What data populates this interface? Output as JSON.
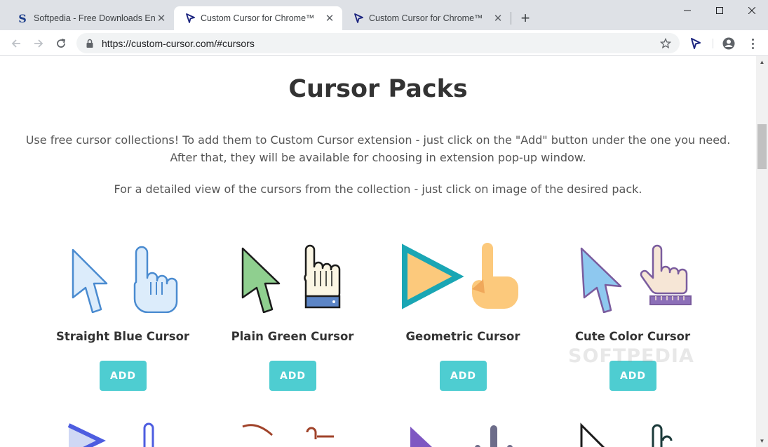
{
  "browser": {
    "tabs": [
      {
        "title": "Softpedia - Free Downloads Ency",
        "icon": "softpedia-icon",
        "active": false
      },
      {
        "title": "Custom Cursor for Chrome™",
        "icon": "custom-cursor-icon",
        "active": true
      },
      {
        "title": "Custom Cursor for Chrome™",
        "icon": "custom-cursor-icon",
        "active": false
      }
    ],
    "new_tab_glyph": "+",
    "url": "https://custom-cursor.com/#cursors"
  },
  "page": {
    "title": "Cursor Packs",
    "intro_line_1": "Use free cursor collections! To add them to Custom Cursor extension - just click on the \"Add\" button under the one you need.",
    "intro_line_2": "After that, they will be available for choosing in extension pop-up window.",
    "intro_line_3": "For a detailed view of the cursors from the collection - just click on image of the desired pack.",
    "packs": [
      {
        "name": "Straight Blue Cursor",
        "button": "ADD"
      },
      {
        "name": "Plain Green Cursor",
        "button": "ADD"
      },
      {
        "name": "Geometric Cursor",
        "button": "ADD"
      },
      {
        "name": "Cute Color Cursor",
        "button": "ADD"
      }
    ]
  },
  "watermark": "SOFTPEDIA",
  "colors": {
    "add_button": "#4ecdd1",
    "title_text": "#333333",
    "body_text": "#555555",
    "titlebar": "#dee1e6"
  }
}
